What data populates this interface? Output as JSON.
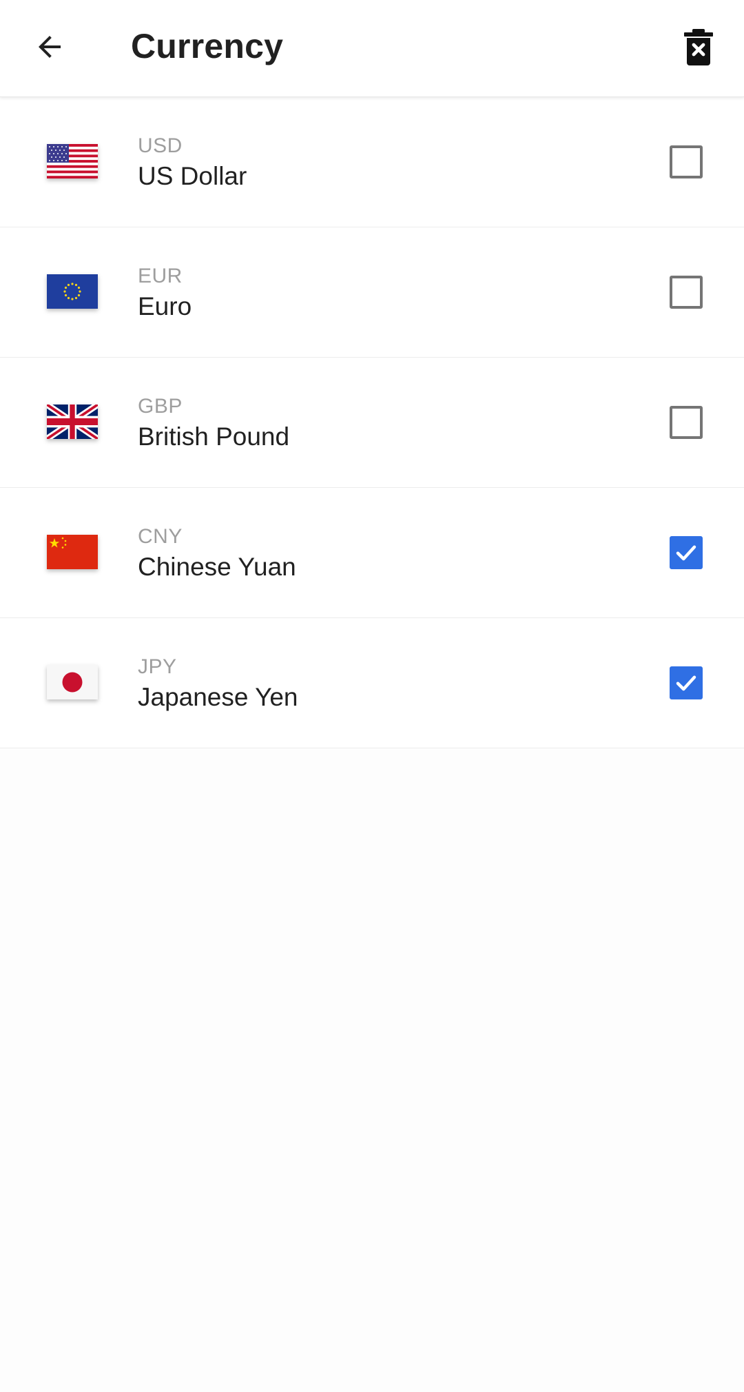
{
  "header": {
    "title": "Currency",
    "back_icon": "arrow-left-icon",
    "delete_icon": "trash-x-icon"
  },
  "currencies": [
    {
      "code": "USD",
      "name": "US Dollar",
      "flag": "us-flag-icon",
      "checked": false
    },
    {
      "code": "EUR",
      "name": "Euro",
      "flag": "eu-flag-icon",
      "checked": false
    },
    {
      "code": "GBP",
      "name": "British Pound",
      "flag": "uk-flag-icon",
      "checked": false
    },
    {
      "code": "CNY",
      "name": "Chinese Yuan",
      "flag": "cn-flag-icon",
      "checked": true
    },
    {
      "code": "JPY",
      "name": "Japanese Yen",
      "flag": "jp-flag-icon",
      "checked": true
    }
  ],
  "colors": {
    "accent": "#2f6fe4",
    "text_primary": "#212121",
    "text_secondary": "#9e9e9e"
  }
}
